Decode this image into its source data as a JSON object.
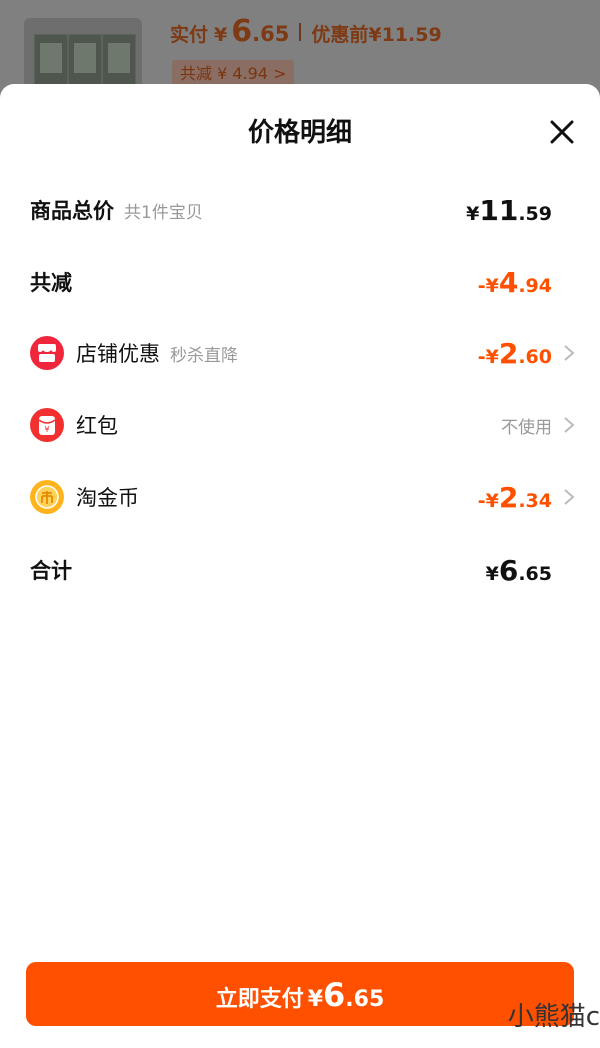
{
  "background_product": {
    "paid_label": "实付",
    "currency": "¥",
    "paid_int": "6",
    "paid_dec": ".65",
    "orig_label": "优惠前",
    "orig_price": "¥11.59",
    "discount_badge": "共减 ¥ 4.94 >"
  },
  "sheet": {
    "title": "价格明细"
  },
  "rows": {
    "subtotal": {
      "label": "商品总价",
      "sub": "共1件宝贝",
      "cur": "¥",
      "int": "11",
      "dec": ".59"
    },
    "total_discount": {
      "label": "共减",
      "cur": "-¥",
      "int": "4",
      "dec": ".94"
    },
    "shop": {
      "label": "店铺优惠",
      "sub": "秒杀直降",
      "cur": "-¥",
      "int": "2",
      "dec": ".60"
    },
    "redpacket": {
      "label": "红包",
      "status": "不使用"
    },
    "coin": {
      "label": "淘金币",
      "cur": "-¥",
      "int": "2",
      "dec": ".34"
    },
    "total": {
      "label": "合计",
      "cur": "¥",
      "int": "6",
      "dec": ".65"
    }
  },
  "pay_button": {
    "label": "立即支付",
    "cur": "¥",
    "int": "6",
    "dec": ".65"
  },
  "watermark": "小熊猫c",
  "colors": {
    "accent": "#ff5000",
    "shop_icon": "#f0263c",
    "redpacket_icon": "#f23030",
    "coin_icon": "#ffb41e"
  }
}
